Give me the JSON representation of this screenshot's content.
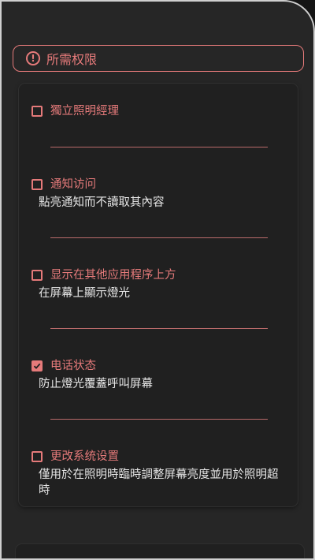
{
  "header": {
    "title": "所需权限",
    "icon": "alert-circle-icon"
  },
  "permissions": [
    {
      "title": "獨立照明經理",
      "description": "",
      "checked": false
    },
    {
      "title": "通知访问",
      "description": "點亮通知而不讀取其內容",
      "checked": false
    },
    {
      "title": "显示在其他应用程序上方",
      "description": "在屏幕上顯示燈光",
      "checked": false
    },
    {
      "title": "电话状态",
      "description": "防止燈光覆蓋呼叫屏幕",
      "checked": true
    },
    {
      "title": "更改系统设置",
      "description": "僅用於在照明時臨時調整屏幕亮度並用於照明超時",
      "checked": false
    }
  ],
  "colors": {
    "accent": "#e57a7a",
    "background": "#262626",
    "card": "#202020",
    "text": "#e6e6e6"
  }
}
